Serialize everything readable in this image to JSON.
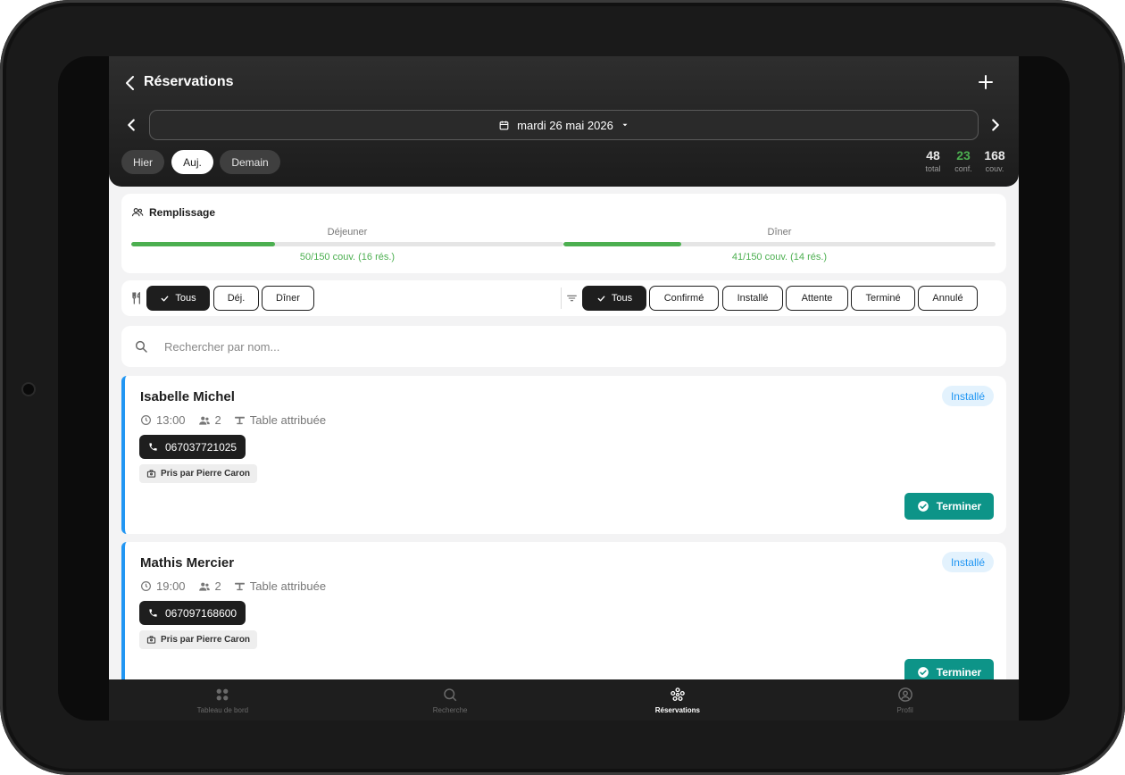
{
  "header": {
    "title": "Réservations"
  },
  "date": {
    "label": "mardi 26 mai 2026"
  },
  "day_chips": [
    {
      "label": "Hier",
      "active": false
    },
    {
      "label": "Auj.",
      "active": true
    },
    {
      "label": "Demain",
      "active": false
    }
  ],
  "stats": [
    {
      "value": "48",
      "label": "total"
    },
    {
      "value": "23",
      "label": "conf."
    },
    {
      "value": "168",
      "label": "couv."
    }
  ],
  "remplissage": {
    "title": "Remplissage",
    "services": [
      {
        "label": "Déjeuner",
        "summary": "50/150 couv. (16 rés.)",
        "fill": 0.333
      },
      {
        "label": "Dîner",
        "summary": "41/150 couv. (14 rés.)",
        "fill": 0.273
      }
    ]
  },
  "service_filters": [
    "Tous",
    "Déj.",
    "Dîner"
  ],
  "status_filters": [
    "Tous",
    "Confirmé",
    "Installé",
    "Attente",
    "Terminé",
    "Annulé"
  ],
  "search": {
    "placeholder": "Rechercher par nom..."
  },
  "reservations": [
    {
      "name": "Isabelle Michel",
      "status": "Installé",
      "time": "13:00",
      "guests": "2",
      "table": "Table attribuée",
      "phone": "067037721025",
      "taken_by": "Pris par Pierre Caron",
      "action": "Terminer"
    },
    {
      "name": "Mathis Mercier",
      "status": "Installé",
      "time": "19:00",
      "guests": "2",
      "table": "Table attribuée",
      "phone": "067097168600",
      "taken_by": "Pris par Pierre Caron",
      "action": "Terminer"
    }
  ],
  "nav": [
    {
      "label": "Tableau de bord",
      "icon": "dashboard-icon"
    },
    {
      "label": "Recherche",
      "icon": "search-icon"
    },
    {
      "label": "Réservations",
      "icon": "reservations-icon",
      "active": true
    },
    {
      "label": "Profil",
      "icon": "profile-icon"
    }
  ],
  "colors": {
    "accent": "#4caf50",
    "status_installe": "#2196f3",
    "action": "#0d9488"
  }
}
